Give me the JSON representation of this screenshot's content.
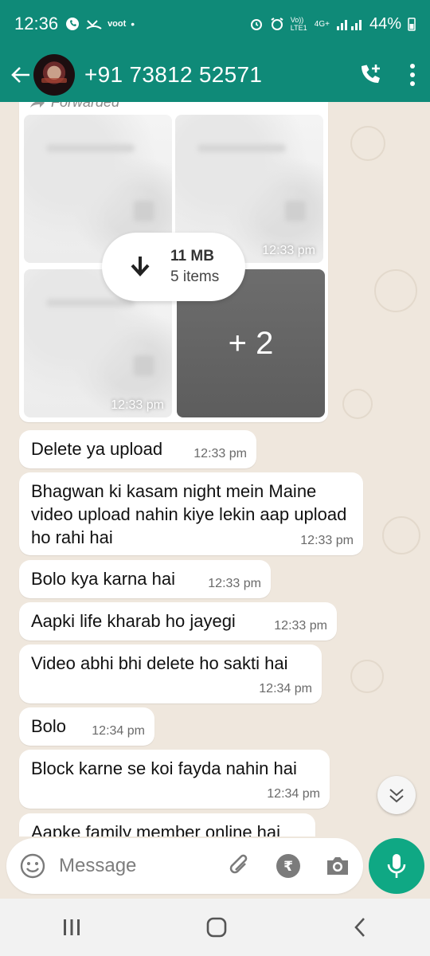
{
  "status_bar": {
    "time": "12:36",
    "network": "Vo)) LTE1",
    "network_type": "4G+",
    "battery": "44%"
  },
  "header": {
    "contact": "+91 73812 52571"
  },
  "media_message": {
    "forwarded_label": "Forwarded",
    "download_size": "11 MB",
    "item_count": "5 items",
    "more_count": "+ 2",
    "tile_times": [
      "12:33 pm",
      "12:33 pm"
    ]
  },
  "messages": [
    {
      "text": "Delete ya upload",
      "time": "12:33 pm"
    },
    {
      "text": "Bhagwan ki kasam night mein Maine video upload nahin kiye lekin aap upload ho rahi hai",
      "time": "12:33 pm"
    },
    {
      "text": "Bolo kya karna hai",
      "time": "12:33 pm"
    },
    {
      "text": "Aapki life kharab ho jayegi",
      "time": "12:33 pm"
    },
    {
      "text": "Video abhi bhi delete ho sakti hai",
      "time": "12:34 pm"
    },
    {
      "text": "Bolo",
      "time": "12:34 pm"
    },
    {
      "text": "Block karne se koi fayda nahin hai",
      "time": "12:34 pm"
    },
    {
      "text": "Aapke family member online hai",
      "time": ""
    }
  ],
  "composer": {
    "placeholder": "Message"
  },
  "colors": {
    "header": "#0f8a78",
    "mic_button": "#0fa884",
    "wallpaper": "#efe7dd"
  }
}
